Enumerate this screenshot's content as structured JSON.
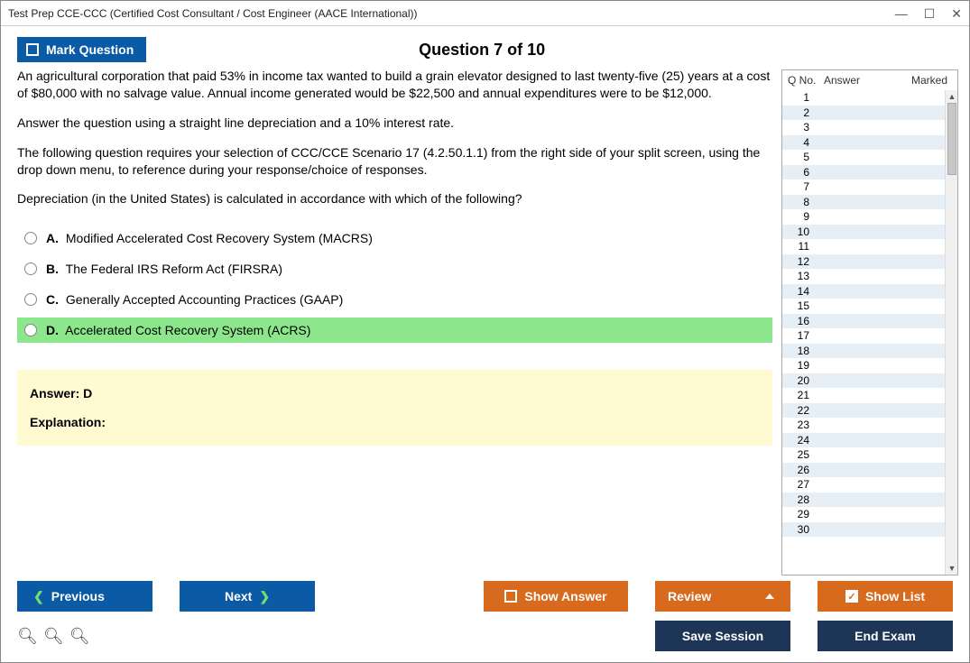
{
  "window": {
    "title": "Test Prep CCE-CCC (Certified Cost Consultant / Cost Engineer (AACE International))"
  },
  "header": {
    "mark_label": "Mark Question",
    "question_title": "Question 7 of 10"
  },
  "question": {
    "p1": "An agricultural corporation that paid 53% in income tax wanted to build a grain elevator designed to last twenty-five (25) years at a cost of $80,000 with no salvage value. Annual income generated would be $22,500 and annual expenditures were to be $12,000.",
    "p2": "Answer the question using a straight line depreciation and a 10% interest rate.",
    "p3": "The following question requires your selection of CCC/CCE Scenario 17 (4.2.50.1.1) from the right side of your split screen, using the drop down menu, to reference during your response/choice of responses.",
    "p4": "Depreciation (in the United States) is calculated in accordance with which of the following?"
  },
  "options": {
    "a_letter": "A.",
    "a_text": "Modified Accelerated Cost Recovery System (MACRS)",
    "b_letter": "B.",
    "b_text": "The Federal IRS Reform Act (FIRSRA)",
    "c_letter": "C.",
    "c_text": "Generally Accepted Accounting Practices (GAAP)",
    "d_letter": "D.",
    "d_text": "Accelerated Cost Recovery System (ACRS)"
  },
  "answer_panel": {
    "answer": "Answer: D",
    "explanation": "Explanation:"
  },
  "side": {
    "h_q": "Q No.",
    "h_a": "Answer",
    "h_m": "Marked",
    "rows": {
      "r1": "1",
      "r2": "2",
      "r3": "3",
      "r4": "4",
      "r5": "5",
      "r6": "6",
      "r7": "7",
      "r8": "8",
      "r9": "9",
      "r10": "10",
      "r11": "11",
      "r12": "12",
      "r13": "13",
      "r14": "14",
      "r15": "15",
      "r16": "16",
      "r17": "17",
      "r18": "18",
      "r19": "19",
      "r20": "20",
      "r21": "21",
      "r22": "22",
      "r23": "23",
      "r24": "24",
      "r25": "25",
      "r26": "26",
      "r27": "27",
      "r28": "28",
      "r29": "29",
      "r30": "30"
    }
  },
  "footer": {
    "previous": "Previous",
    "next": "Next",
    "show_answer": "Show Answer",
    "review": "Review",
    "show_list": "Show List",
    "save_session": "Save Session",
    "end_exam": "End Exam"
  }
}
